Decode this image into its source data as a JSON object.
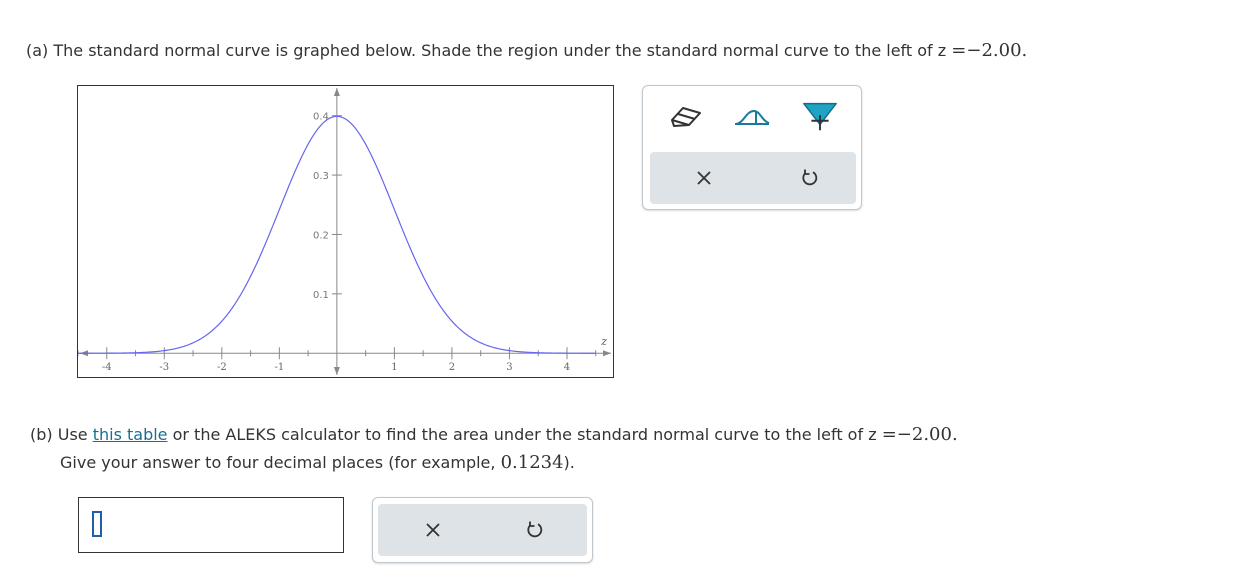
{
  "part_a": {
    "prefix": "(a) The standard normal curve is graphed below. Shade the region under the standard normal curve to the left of ",
    "variable": "z",
    "equals": "=",
    "value": "−2.00",
    "suffix": "."
  },
  "graph": {
    "axis_label": "z",
    "x_ticks": [
      "-4",
      "-3",
      "-2",
      "-1",
      "1",
      "2",
      "3",
      "4"
    ],
    "y_ticks": [
      "0.1",
      "0.2",
      "0.3",
      "0.4"
    ],
    "curve_color": "#6666ee"
  },
  "chart_data": {
    "type": "line",
    "series": [
      {
        "function": "standard normal density",
        "x": [
          -4.5,
          -4,
          -3.5,
          -3,
          -2.5,
          -2,
          -1.5,
          -1,
          -0.5,
          0,
          0.5,
          1,
          1.5,
          2,
          2.5,
          3,
          3.5,
          4,
          4.5
        ],
        "y": [
          0.0,
          0.0001,
          0.0009,
          0.0044,
          0.0175,
          0.054,
          0.1295,
          0.242,
          0.3521,
          0.3989,
          0.3521,
          0.242,
          0.1295,
          0.054,
          0.0175,
          0.0044,
          0.0009,
          0.0001,
          0.0
        ]
      }
    ],
    "xlabel": "z",
    "ylabel": "",
    "xlim": [
      -4.5,
      4.8
    ],
    "ylim": [
      -0.04,
      0.45
    ],
    "x_tick_values": [
      -4,
      -3,
      -2,
      -1,
      1,
      2,
      3,
      4
    ],
    "y_tick_values": [
      0.1,
      0.2,
      0.3,
      0.4
    ]
  },
  "tools": {
    "eraser_icon": "eraser-icon",
    "curve_tool_icon": "normal-curve-tool-icon",
    "shade_tool_icon": "shade-region-icon",
    "shade_color": "#1ea3c4",
    "clear_icon": "x-icon",
    "undo_icon": "undo-icon"
  },
  "part_b": {
    "prefix": "(b) Use ",
    "link_text": "this table",
    "middle": " or the ALEKS calculator to find the area under the standard normal curve to the left of ",
    "variable": "z",
    "equals": "=",
    "value": "−2.00",
    "suffix": ".",
    "line2_prefix": "Give your answer to four decimal places (for example, ",
    "example": "0.1234",
    "line2_suffix": ")."
  },
  "answer": {
    "value": ""
  }
}
